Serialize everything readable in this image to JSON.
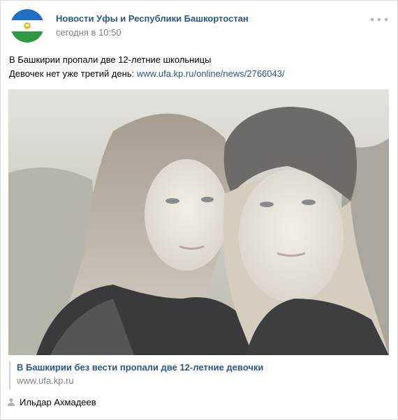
{
  "post": {
    "group_name": "Новости Уфы и Республики Башкортостан",
    "time": "сегодня в 10:50",
    "more_icon": "more-horizontal-icon",
    "text_line1": "В Башкирии пропали две 12-летние школьницы",
    "text_line2_prefix": "Девочек нет уже третий день: ",
    "text_link": "www.ufa.kp.ru/online/news/2766043/",
    "snippet": {
      "title": "В Башкирии без вести пропали две 12-летние девочки",
      "domain": "www.ufa.kp.ru"
    },
    "author": {
      "icon": "user-icon",
      "name": "Ильдар Ахмадеев"
    }
  },
  "colors": {
    "link": "#2a5885",
    "muted": "#828282",
    "flag_blue": "#1f6fc7",
    "flag_white": "#ffffff",
    "flag_green": "#2c9a43"
  }
}
